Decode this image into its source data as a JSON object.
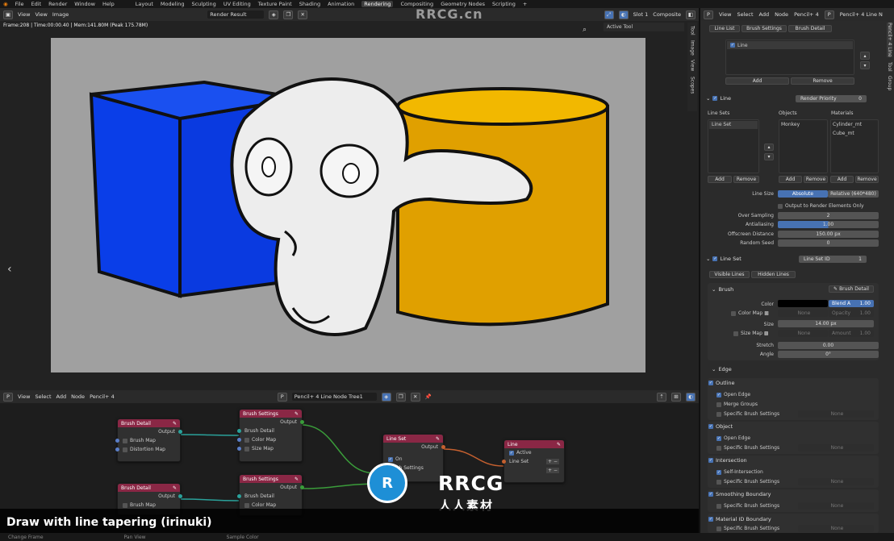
{
  "topbar": {
    "menus": [
      "File",
      "Edit",
      "Render",
      "Window",
      "Help"
    ],
    "workspaces": [
      "Layout",
      "Modeling",
      "Sculpting",
      "UV Editing",
      "Texture Paint",
      "Shading",
      "Animation",
      "Rendering",
      "Compositing",
      "Geometry Nodes",
      "Scripting"
    ],
    "active_workspace": "Rendering",
    "add": "+"
  },
  "image_editor": {
    "menu": [
      "View",
      "View",
      "Image"
    ],
    "image_name": "Render Result",
    "slot": "Slot 1",
    "layer": "Composite",
    "info": "Frame:208 | Time:00:00.40 | Mem:141.80M (Peak 175.78M)",
    "active_tool": "Active Tool",
    "side_tabs": [
      "Tool",
      "Image",
      "View",
      "Scopes"
    ]
  },
  "watermark": {
    "top": "RRCG.cn",
    "logo_big": "RRCG",
    "logo_cn": "人人素材"
  },
  "node_editor": {
    "menu": [
      "View",
      "Select",
      "Add",
      "Node",
      "Pencil+ 4"
    ],
    "tree_name": "Pencil+ 4 Line Node Tree1",
    "nodes": {
      "brush_detail_1": {
        "title": "Brush Detail",
        "output": "Output",
        "rows": [
          "Brush Map",
          "Distortion Map"
        ]
      },
      "brush_settings_1": {
        "title": "Brush Settings",
        "output": "Output",
        "rows": [
          "Brush Detail",
          "Color Map",
          "Size Map"
        ]
      },
      "line_set": {
        "title": "Line Set",
        "output": "Output",
        "rows": [
          "On",
          "Brush Settings"
        ]
      },
      "line": {
        "title": "Line",
        "rows": [
          "Active",
          "Line Set"
        ]
      },
      "brush_detail_2": {
        "title": "Brush Detail",
        "output": "Output",
        "rows": [
          "Brush Map"
        ]
      },
      "brush_settings_2": {
        "title": "Brush Settings",
        "output": "Output",
        "rows": [
          "Brush Detail",
          "Color Map",
          "Size Map"
        ]
      }
    }
  },
  "caption": "Draw with line tapering (irinuki)",
  "bottom_status": [
    "Change Frame",
    "Pan View",
    "Sample Color"
  ],
  "properties": {
    "menu": [
      "View",
      "Select",
      "Add",
      "Node",
      "Pencil+ 4"
    ],
    "header_right": "Pencil+ 4 Line N",
    "tabs": [
      "Line List",
      "Brush Settings",
      "Brush Detail"
    ],
    "line_list": {
      "item": "Line",
      "add": "Add",
      "remove": "Remove"
    },
    "line_section": {
      "title": "Line",
      "render_priority_label": "Render Priority",
      "render_priority": "0"
    },
    "columns": {
      "line_sets": "Line Sets",
      "objects": "Objects",
      "materials": "Materials",
      "line_set_item": "Line Set",
      "object_item": "Monkey",
      "material_items": [
        "Cylinder_mt",
        "Cube_mt"
      ],
      "add": "Add",
      "remove": "Remove"
    },
    "line_size": {
      "label": "Line Size",
      "absolute": "Absolute",
      "relative": "Relative (640*480)"
    },
    "output_only": "Output to Render Elements Only",
    "over_sampling": {
      "label": "Over Sampling",
      "value": "2"
    },
    "antialiasing": {
      "label": "Antialiasing",
      "value": "1.00"
    },
    "offscreen": {
      "label": "Offscreen Distance",
      "value": "150.00 px"
    },
    "random_seed": {
      "label": "Random Seed",
      "value": "0"
    },
    "line_set_section": {
      "title": "Line Set",
      "id_label": "Line Set ID",
      "id": "1"
    },
    "line_tabs": [
      "Visible Lines",
      "Hidden Lines"
    ],
    "brush": {
      "title": "Brush",
      "detail_btn": "Brush Detail",
      "color_label": "Color",
      "blend": "Blend A",
      "blend_val": "1.00",
      "color_map": "Color Map",
      "none": "None",
      "opacity": "Opacity",
      "opacity_val": "1.00",
      "size_label": "Size",
      "size": "14.00 px",
      "size_map": "Size Map",
      "amount": "Amount",
      "amount_val": "1.00",
      "stretch_label": "Stretch",
      "stretch": "0.00",
      "angle_label": "Angle",
      "angle": "0°"
    },
    "edge": {
      "title": "Edge",
      "groups": [
        {
          "name": "Outline",
          "items": [
            "Open Edge",
            "Merge Groups",
            "Specific Brush Settings"
          ],
          "checks": [
            true,
            false,
            false
          ]
        },
        {
          "name": "Object",
          "items": [
            "Open Edge",
            "Specific Brush Settings"
          ],
          "checks": [
            true,
            false
          ]
        },
        {
          "name": "Intersection",
          "items": [
            "Self-Intersection",
            "Specific Brush Settings"
          ],
          "checks": [
            true,
            false
          ]
        },
        {
          "name": "Smoothing Boundary",
          "items": [
            "Specific Brush Settings"
          ],
          "checks": [
            false
          ]
        },
        {
          "name": "Material ID Boundary",
          "items": [
            "Specific Brush Settings"
          ],
          "checks": [
            false
          ]
        }
      ],
      "none": "None"
    },
    "side_tabs": [
      "Pencil+ 4 Line",
      "Tool",
      "Group"
    ]
  },
  "colors": {
    "cube": "#0a3ee8",
    "cylinder": "#e8a600",
    "node_header": "#8a2745",
    "accent": "#4772b3"
  }
}
